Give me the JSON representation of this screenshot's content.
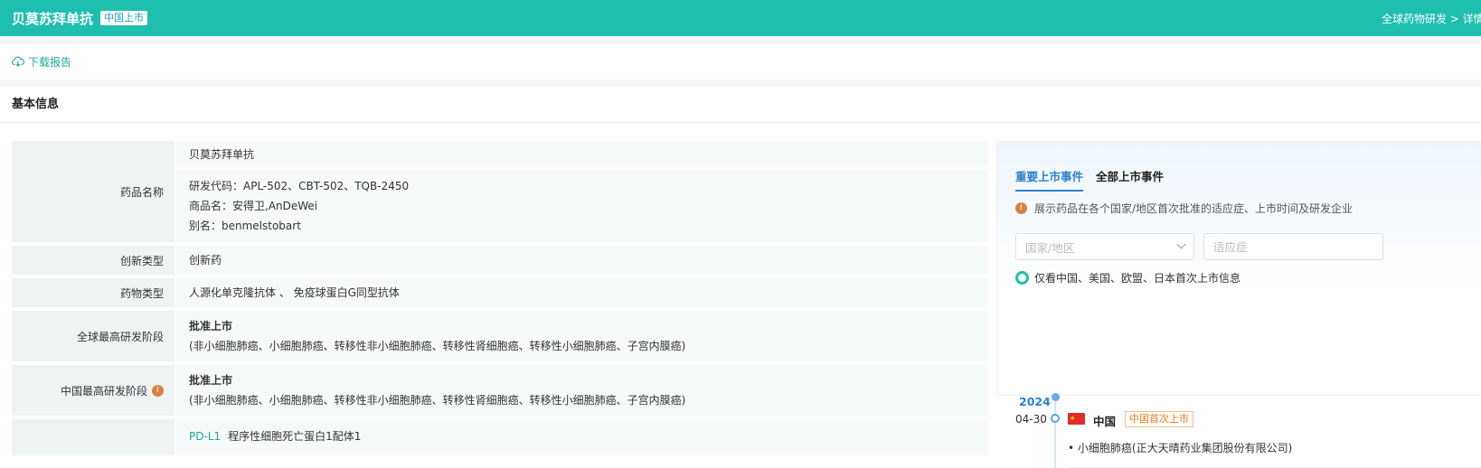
{
  "header": {
    "title": "贝莫苏拜单抗",
    "tag": "中国上市",
    "breadcrumb": "全球药物研发 > 详情"
  },
  "toolbar": {
    "download_label": "下载报告"
  },
  "basic_info": {
    "section_title": "基本信息",
    "rows": [
      {
        "label": "药品名称",
        "name_cn": "贝莫苏拜单抗",
        "codes": "研发代码：APL-502、CBT-502、TQB-2450",
        "trade_name": "商品名：安得卫,AnDeWei",
        "alias": "别名：benmelstobart"
      },
      {
        "label": "创新类型",
        "value": "创新药"
      },
      {
        "label": "药物类型",
        "value": "人源化单克隆抗体 、 免疫球蛋白G同型抗体"
      },
      {
        "label": "全球最高研发阶段",
        "stage": "批准上市",
        "indications": "(非小细胞肺癌、小细胞肺癌、转移性非小细胞肺癌、转移性肾细胞癌、转移性小细胞肺癌、子宫内膜癌)"
      },
      {
        "label": "中国最高研发阶段",
        "stage": "批准上市",
        "indications": "(非小细胞肺癌、小细胞肺癌、转移性非小细胞肺癌、转移性肾细胞癌、转移性小细胞肺癌、子宫内膜癌)"
      },
      {
        "label": "",
        "target": "PD-L1",
        "target_desc": "程序性细胞死亡蛋白1配体1"
      }
    ]
  },
  "launch_panel": {
    "tabs": [
      "重要上市事件",
      "全部上市事件"
    ],
    "active_tab": 0,
    "hint": "展示药品在各个国家/地区首次批准的适应症、上市时间及研发企业",
    "country_select_placeholder": "国家/地区",
    "indication_input_placeholder": "适应症",
    "toggle_label": "仅看中国、美国、欧盟、日本首次上市信息",
    "timeline": {
      "year": "2024",
      "date": "04-30",
      "country": "中国",
      "badge": "中国首次上市",
      "item": "小细胞肺癌(正大天晴药业集团股份有限公司)"
    }
  },
  "colors": {
    "brand": "#1fbfb0",
    "link": "#1aa89a",
    "tab_active": "#2a7fd0",
    "badge_orange": "#f07a1a"
  },
  "icons": [
    "cloud-download-icon",
    "info-icon",
    "chevron-down-icon",
    "china-flag-icon"
  ]
}
